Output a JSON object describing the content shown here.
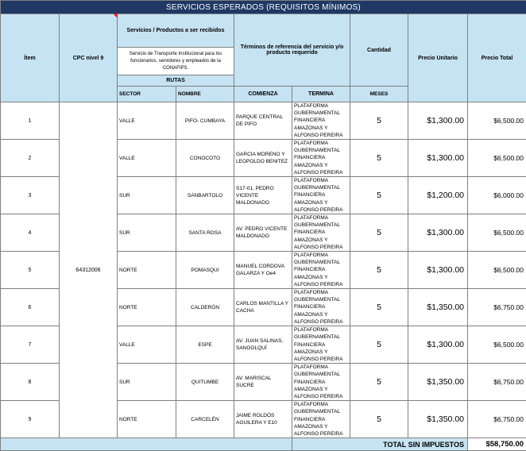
{
  "title": "SERVICIOS ESPERADOS (REQUISITOS MÍNIMOS)",
  "headers": {
    "item": "Ítem",
    "cpc": "CPC nivel 9",
    "servicios": "Servicios / Productos a ser recibidos",
    "servicios_desc": "Servicio de Transporte Institucional para los funcionarios, servidores y empleados de la CONAFIPS.",
    "terminos": "Términos de referencia del servicio y/o producto requerido",
    "cantidad": "Cantidad",
    "precio_unitario": "Precio Unitario",
    "precio_total": "Precio Total",
    "rutas": "RUTAS",
    "sector": "SECTOR",
    "nombre": "NOMBRE",
    "comienza": "COMIENZA",
    "termina": "TERMINA",
    "meses": "MESES"
  },
  "cpc_value": "64312006",
  "rows": [
    {
      "item": "1",
      "sector": "VALLE",
      "nombre": "PIFO- CUMBAYA",
      "comienza": "PARQUE CENTRAL DE PIFO",
      "termina": "PLATAFORMA GUBERNAMENTAL FINANCIERA AMAZONAS Y ALFONSO PEREIRA",
      "cantidad": "5",
      "precio_unitario": "$1,300.00",
      "precio_total": "$6,500.00"
    },
    {
      "item": "2",
      "sector": "VALLE",
      "nombre": "CONOCOTO",
      "comienza": "GARCIA MORENO Y LEOPOLDO BENITEZ",
      "termina": "PLATAFORMA GUBERNAMENTAL FINANCIERA AMAZONAS Y ALFONSO PEREIRA",
      "cantidad": "5",
      "precio_unitario": "$1,300.00",
      "precio_total": "$6,500.00"
    },
    {
      "item": "3",
      "sector": "SUR",
      "nombre": "SANBARTOLO",
      "comienza": "S17-01, PEDRO VICENTE MALDONADO",
      "termina": "PLATAFORMA GUBERNAMENTAL FINANCIERA AMAZONAS Y ALFONSO PEREIRA",
      "cantidad": "5",
      "precio_unitario": "$1,200.00",
      "precio_total": "$6,000.00"
    },
    {
      "item": "4",
      "sector": "SUR",
      "nombre": "SANTA ROSA",
      "comienza": "AV. PEDRO VICENTE MALDONADO",
      "termina": "PLATAFORMA GUBERNAMENTAL FINANCIERA AMAZONAS Y ALFONSO PEREIRA",
      "cantidad": "5",
      "precio_unitario": "$1,300.00",
      "precio_total": "$6,500.00"
    },
    {
      "item": "5",
      "sector": "NORTE",
      "nombre": "POMASQUI",
      "comienza": "MANUEL CORDOVA GALARZA Y Oe4",
      "termina": "PLATAFORMA GUBERNAMENTAL FINANCIERA AMAZONAS Y ALFONSO PEREIRA",
      "cantidad": "5",
      "precio_unitario": "$1,300.00",
      "precio_total": "$6,500.00"
    },
    {
      "item": "6",
      "sector": "NORTE",
      "nombre": "CALDERÓN",
      "comienza": "CARLOS MANTILLA Y CACHA",
      "termina": "PLATAFORMA GUBERNAMENTAL FINANCIERA AMAZONAS Y ALFONSO PEREIRA",
      "cantidad": "5",
      "precio_unitario": "$1,350.00",
      "precio_total": "$6,750.00"
    },
    {
      "item": "7",
      "sector": "VALLE",
      "nombre": "ESPE",
      "comienza": "AV. JUAN SALINAS, SANGOLQUÍ",
      "termina": "PLATAFORMA GUBERNAMENTAL FINANCIERA AMAZONAS Y ALFONSO PEREIRA",
      "cantidad": "5",
      "precio_unitario": "$1,300.00",
      "precio_total": "$6,500.00"
    },
    {
      "item": "8",
      "sector": "SUR",
      "nombre": "QUITUMBE",
      "comienza": "AV. MARISCAL SUCRE",
      "termina": "PLATAFORMA GUBERNAMENTAL FINANCIERA AMAZONAS Y ALFONSO PEREIRA",
      "cantidad": "5",
      "precio_unitario": "$1,350.00",
      "precio_total": "$6,750.00"
    },
    {
      "item": "9",
      "sector": "NORTE",
      "nombre": "CARCELÉN",
      "comienza": "JAIME ROLDÓS AGUILERA Y E10",
      "termina": "PLATAFORMA GUBERNAMENTAL FINANCIERA AMAZONAS Y ALFONSO PEREIRA",
      "cantidad": "5",
      "precio_unitario": "$1,350.00",
      "precio_total": "$6,750.00"
    }
  ],
  "footer": {
    "label": "TOTAL SIN IMPUESTOS",
    "value": "$58,750.00"
  },
  "colors": {
    "title_bg": "#1f3864",
    "header_bg": "#c6e3f3",
    "comment_marker": "#e02020"
  }
}
